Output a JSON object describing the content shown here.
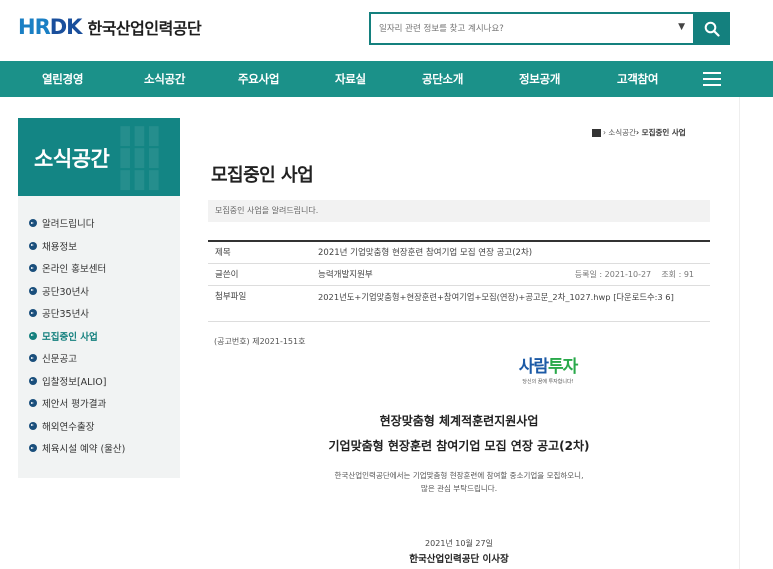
{
  "header": {
    "logo_mark_a": "HR",
    "logo_mark_b": "DK",
    "logo_text": "한국산업인력공단",
    "search_placeholder": "일자리 관련 정보를 찾고 계시나요?"
  },
  "nav": {
    "items": [
      "열린경영",
      "소식공간",
      "주요사업",
      "자료실",
      "공단소개",
      "정보공개",
      "고객참여"
    ]
  },
  "sidebar": {
    "title": "소식공간",
    "items": [
      {
        "label": "알려드립니다"
      },
      {
        "label": "채용정보"
      },
      {
        "label": "온라인 홍보센터"
      },
      {
        "label": "공단30년사"
      },
      {
        "label": "공단35년사"
      },
      {
        "label": "모집중인 사업",
        "active": true
      },
      {
        "label": "신문공고"
      },
      {
        "label": "입찰정보[ALIO]"
      },
      {
        "label": "제안서 평가결과"
      },
      {
        "label": "해외연수출장"
      },
      {
        "label": "체육시설 예약 (울산)"
      }
    ]
  },
  "breadcrumb": {
    "parent": "› 소식공간",
    "current": "› 모집중인 사업"
  },
  "page": {
    "title": "모집중인 사업",
    "description": "모집중인 사업을 알려드립니다."
  },
  "post": {
    "title_label": "제목",
    "title": "2021년 기업맞춤형 현장훈련 참여기업 모집 연장 공고(2차)",
    "author_label": "글쓴이",
    "author": "능력개발지원부",
    "reg_date": "등록일 : 2021-10-27",
    "views": "조회 : 91",
    "file_label": "첨부파일",
    "file": "2021년도+기업맞춤형+현장훈련+참여기업+모집(연장)+공고문_2차_1027.hwp [다운로드수:3 6]"
  },
  "content": {
    "notice_no": "(공고번호) 제2021-151호",
    "brand_main_a": "사람",
    "brand_main_b": "투자",
    "brand_sub": "당신의 꿈에 투자합니다!",
    "heading1": "현장맞춤형 체계적훈련지원사업",
    "heading2": "기업맞춤형 현장훈련 참여기업 모집 연장 공고(2차)",
    "body1": "한국산업인력공단에서는 기업맞춤형 현장훈련에 참여할 중소기업을 모집하오니,",
    "body2": "많은 관심 부탁드립니다.",
    "date": "2021년 10월 27일",
    "signer": "한국산업인력공단 이사장"
  },
  "colors": {
    "primary": "#1b9189",
    "primary_dark": "#138584",
    "logo_blue": "#1a7fc4",
    "brand_blue": "#1c5aa6",
    "brand_green": "#29a94a"
  }
}
